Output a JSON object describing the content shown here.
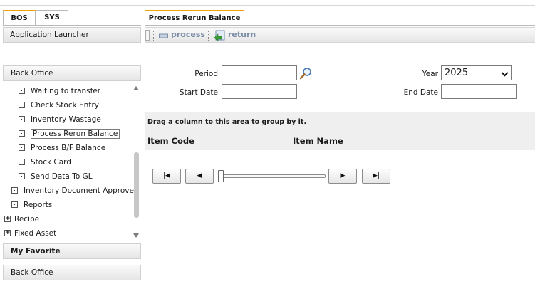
{
  "tabs": [
    {
      "label": "BOS",
      "active": true
    },
    {
      "label": "SYS",
      "active": false
    }
  ],
  "launcher": {
    "label": "Application Launcher"
  },
  "sections": {
    "back_office_top": "Back Office",
    "my_favorite": "My Favorite",
    "back_office_bottom": "Back Office"
  },
  "tree": {
    "items": [
      {
        "label": "Waiting to transfer",
        "level": 2,
        "icon": "bullet-box-icon"
      },
      {
        "label": "Check Stock Entry",
        "level": 2,
        "icon": "bullet-box-icon"
      },
      {
        "label": "Inventory Wastage",
        "level": 2,
        "icon": "bullet-box-icon"
      },
      {
        "label": "Process Rerun Balance",
        "level": 2,
        "icon": "bullet-box-icon",
        "selected": true
      },
      {
        "label": "Process B/F Balance",
        "level": 2,
        "icon": "bullet-box-icon"
      },
      {
        "label": "Stock Card",
        "level": 2,
        "icon": "bullet-box-icon"
      },
      {
        "label": "Send Data To GL",
        "level": 2,
        "icon": "bullet-box-icon"
      },
      {
        "label": "Inventory Document Approve",
        "level": 1,
        "icon": "bullet-box-icon"
      },
      {
        "label": "Reports",
        "level": 1,
        "icon": "bullet-box-icon"
      },
      {
        "label": "Recipe",
        "level": 0,
        "icon": "expand-plus-icon"
      },
      {
        "label": "Fixed Asset",
        "level": 0,
        "icon": "expand-plus-icon"
      }
    ]
  },
  "content_tab": {
    "label": "Process Rerun Balance"
  },
  "toolbar": {
    "process_label": "process",
    "return_label": "return"
  },
  "form": {
    "period_label": "Period",
    "period_value": "",
    "start_date_label": "Start Date",
    "start_date_value": "",
    "year_label": "Year",
    "year_value": "2025",
    "end_date_label": "End Date",
    "end_date_value": ""
  },
  "grid": {
    "group_hint": "Drag a column to this area to group by it.",
    "columns": [
      "Item Code",
      "Item Name"
    ]
  },
  "pager": {
    "first": "|◀",
    "prev": "◀",
    "next": "▶",
    "last": "▶|"
  },
  "colors": {
    "active_tab_accent": "#f0a30a",
    "toolbar_link": "#7d8fa8",
    "grid_header_bg": "#efefef"
  }
}
